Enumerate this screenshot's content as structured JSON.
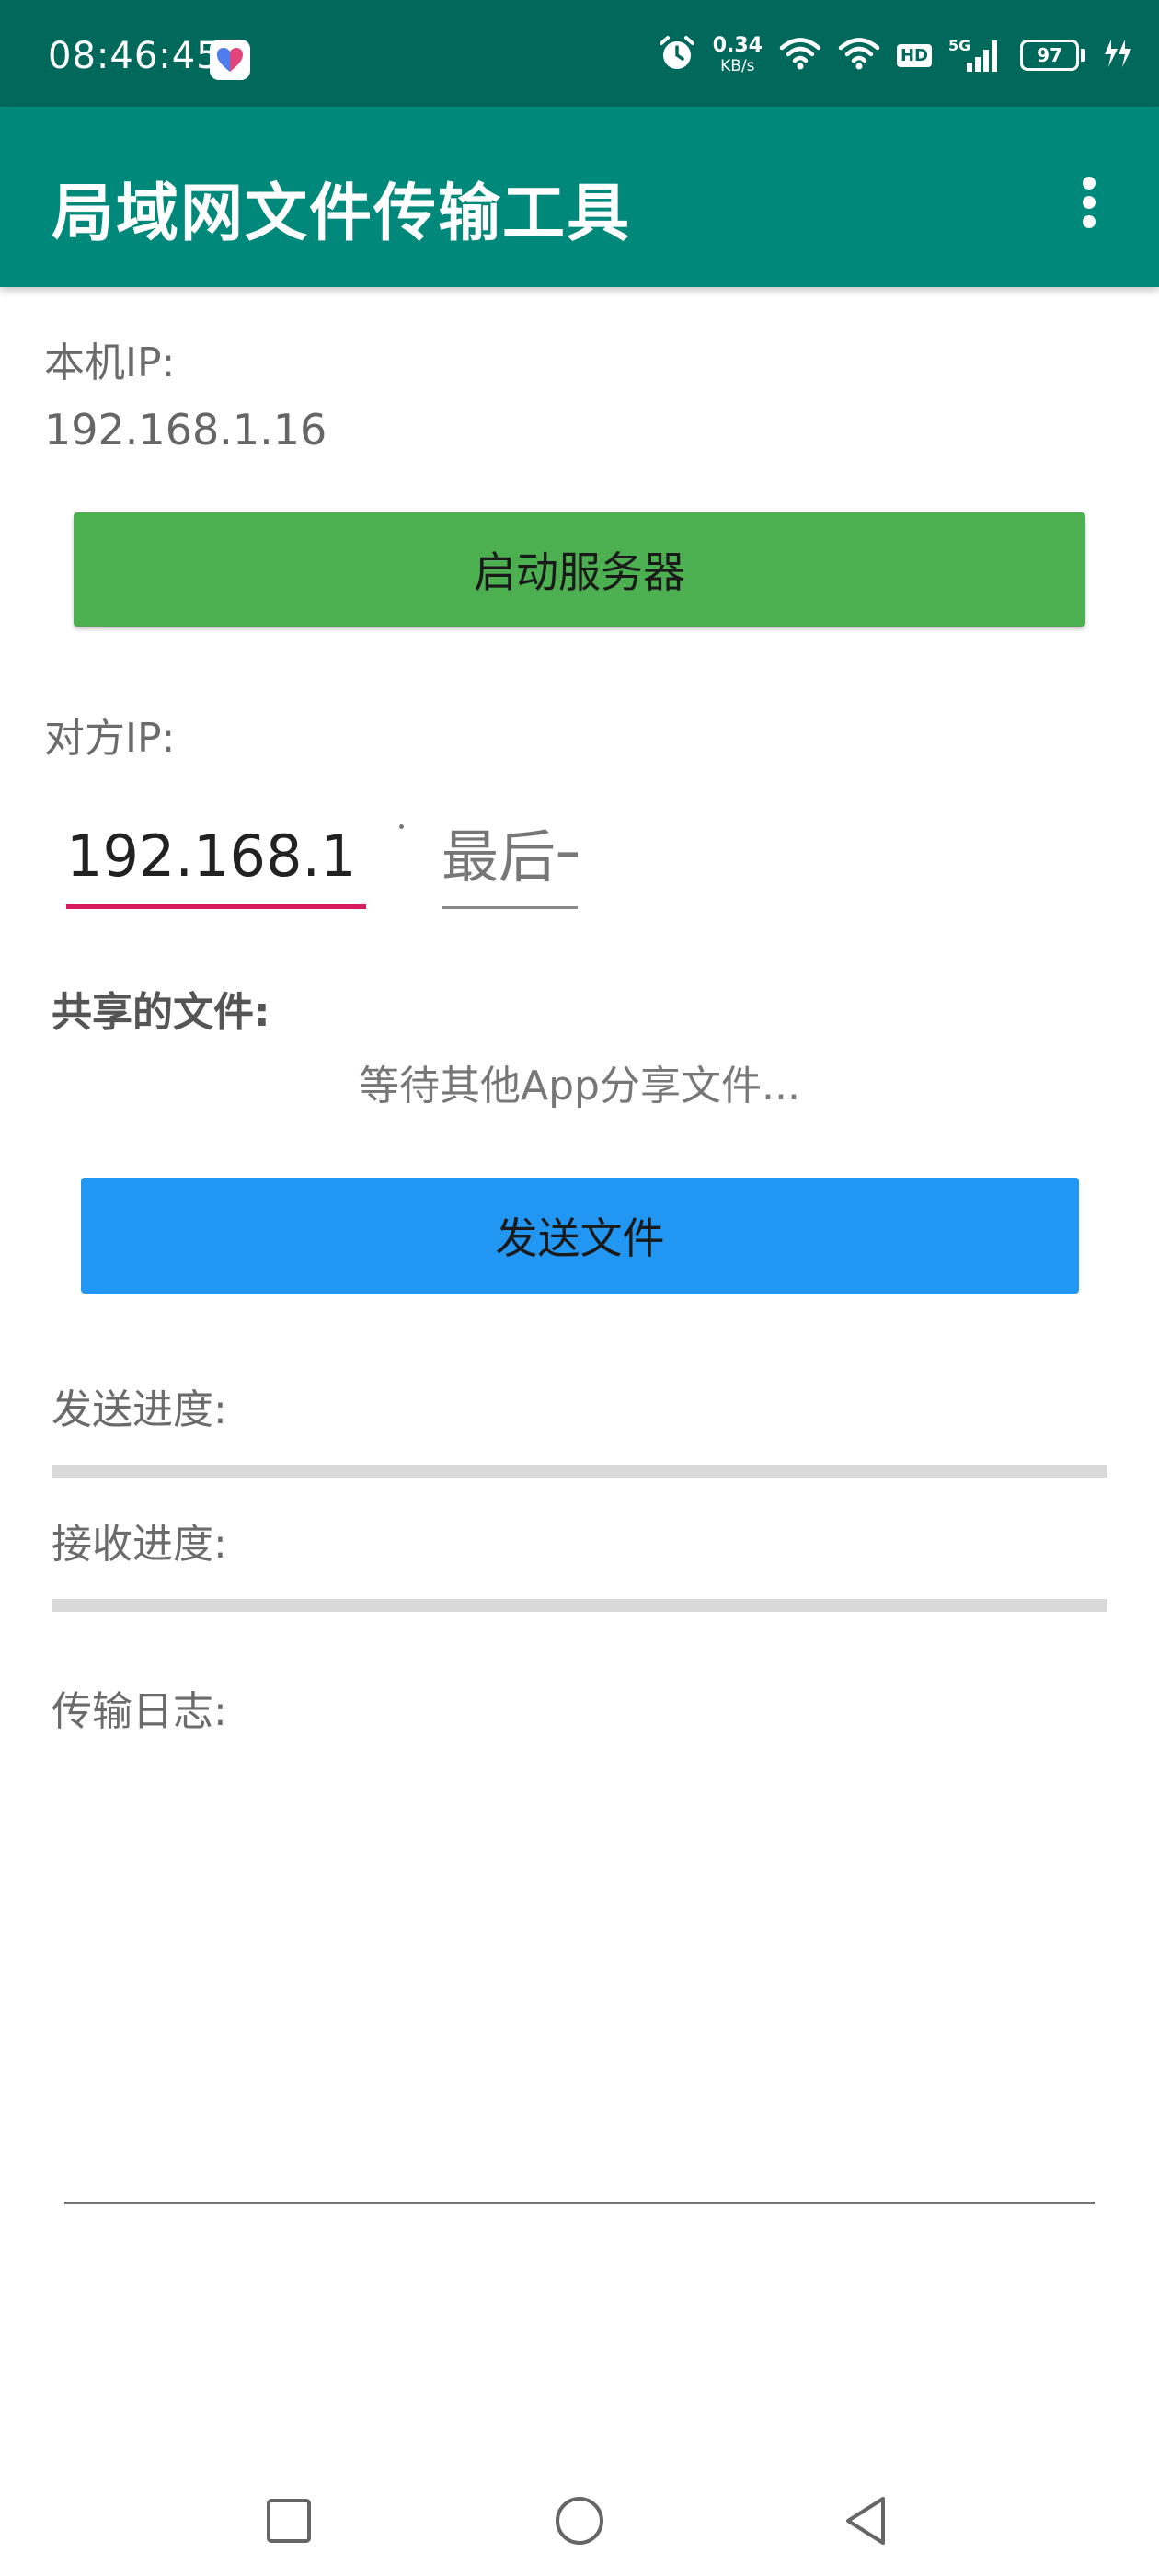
{
  "status_bar": {
    "time": "08:46:45",
    "app_icon": "heart-icon",
    "net_speed_value": "0.34",
    "net_speed_unit": "KB/s",
    "hd_label": "HD",
    "network_label": "5G",
    "battery_level": "97",
    "icons": [
      "alarm-icon",
      "wifi-icon",
      "wifi-icon",
      "hd-badge",
      "signal-icon",
      "battery-icon",
      "charging-icon"
    ]
  },
  "app_bar": {
    "title": "局域网文件传输工具",
    "menu_icon": "more-vert-icon"
  },
  "local_ip": {
    "label": "本机IP:",
    "value": "192.168.1.16"
  },
  "start_server_button": "启动服务器",
  "peer_ip": {
    "label": "对方IP:",
    "prefix_value": "192.168.1",
    "separator": ".",
    "last_octet_placeholder": "最后一位"
  },
  "shared_files": {
    "label": "共享的文件:",
    "status": "等待其他App分享文件..."
  },
  "send_file_button": "发送文件",
  "send_progress": {
    "label": "发送进度:",
    "value": 0
  },
  "receive_progress": {
    "label": "接收进度:",
    "value": 0
  },
  "transfer_log": {
    "label": "传输日志:",
    "content": ""
  },
  "nav_bar": {
    "buttons": [
      "recents-square-icon",
      "home-circle-icon",
      "back-triangle-icon"
    ]
  },
  "colors": {
    "status_bar": "#00695c",
    "app_bar": "#00897b",
    "start_button": "#4caf50",
    "send_button": "#2196f3",
    "input_accent": "#d81b60",
    "progress_track": "#d9d9d9"
  }
}
